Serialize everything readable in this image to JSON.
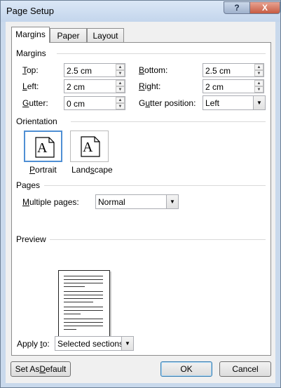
{
  "window": {
    "title": "Page Setup"
  },
  "titlebar": {
    "help_label": "?",
    "close_label": "X"
  },
  "tabs": [
    {
      "label": "Margins",
      "selected": true
    },
    {
      "label": "Paper"
    },
    {
      "label": "Layout"
    }
  ],
  "margins": {
    "group_label": "Margins",
    "top": {
      "label_key": "T",
      "label_rest": "op:",
      "value": "2.5 cm"
    },
    "bottom": {
      "label_key": "B",
      "label_rest": "ottom:",
      "value": "2.5 cm"
    },
    "left": {
      "label_key": "L",
      "label_rest": "eft:",
      "value": "2 cm"
    },
    "right": {
      "label_key": "R",
      "label_rest": "ight:",
      "value": "2 cm"
    },
    "gutter": {
      "label_key": "G",
      "label_rest": "utter:",
      "value": "0 cm"
    },
    "gutter_position": {
      "label_pre": "G",
      "label_key": "u",
      "label_rest": "tter position:",
      "value": "Left"
    }
  },
  "orientation": {
    "group_label": "Orientation",
    "icon_letter": "A",
    "portrait": {
      "label_key": "P",
      "label_rest": "ortrait",
      "selected": true
    },
    "landscape": {
      "label_pre": "Land",
      "label_key": "s",
      "label_rest": "cape"
    }
  },
  "pages": {
    "group_label": "Pages",
    "multiple_pages": {
      "label_key": "M",
      "label_rest": "ultiple pages:",
      "value": "Normal"
    }
  },
  "preview": {
    "group_label": "Preview"
  },
  "apply_to": {
    "label_pre": "Apply ",
    "label_key": "t",
    "label_rest": "o:",
    "value": "Selected sections"
  },
  "footer": {
    "set_default": {
      "label_pre": "Set As ",
      "label_key": "D",
      "label_rest": "efault"
    },
    "ok_label": "OK",
    "cancel_label": "Cancel"
  }
}
